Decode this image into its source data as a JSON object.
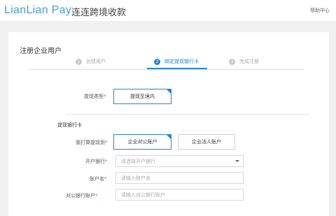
{
  "header": {
    "logo_main": "LianLian",
    "logo_pay": " Pay",
    "brand": "连连跨境收款",
    "help": "帮助中心"
  },
  "form": {
    "title": "注册企业用户",
    "steps": [
      {
        "num": "1",
        "label": "创建用户",
        "active": false
      },
      {
        "num": "2",
        "label": "绑定提现银行卡",
        "active": true
      },
      {
        "num": "3",
        "label": "完成注册",
        "active": false
      }
    ],
    "withdraw_type": {
      "label": "提现类型",
      "option": "提现至境内"
    },
    "bank_section": {
      "title": "提现银行卡",
      "plan_label": "我打算提现到",
      "options": [
        "企业对公账户",
        "企业法人账户"
      ],
      "bank": {
        "label": "开户银行",
        "placeholder": "请选择开户银行"
      },
      "account_name": {
        "label": "账户名",
        "placeholder": "请输入账户名"
      },
      "account_no": {
        "label": "对公银行账户",
        "placeholder": "请输入对公银行账户"
      }
    },
    "required_mark": "*"
  },
  "colors": {
    "accent": "#2a85d0",
    "logo": "#4a9bd6",
    "required": "#e04b4b"
  }
}
